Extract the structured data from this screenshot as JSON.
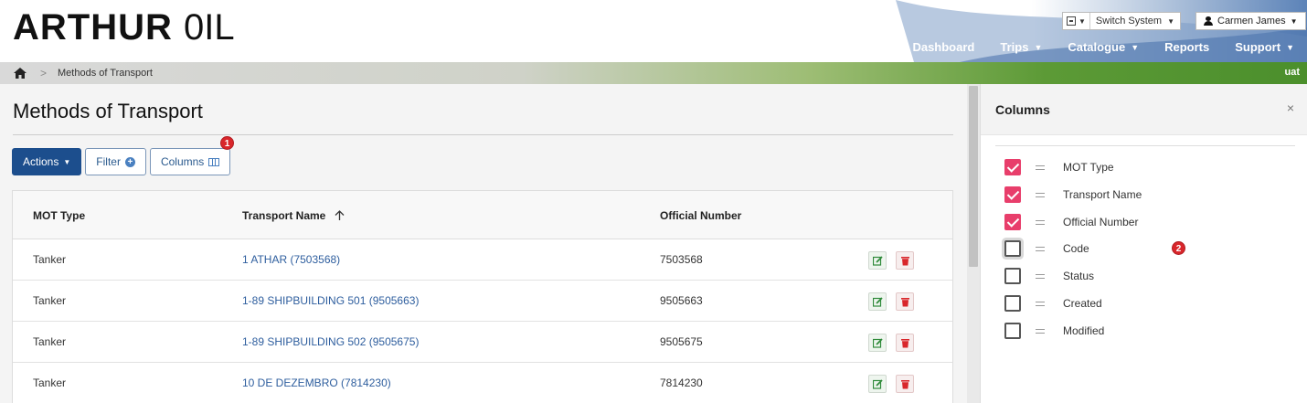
{
  "brand": {
    "logo_bold": "ARTHUR",
    "logo_thin": "0IL"
  },
  "header": {
    "system_switch_label": "Switch System",
    "user_name": "Carmen James",
    "nav": [
      {
        "label": "Dashboard",
        "has_menu": false
      },
      {
        "label": "Trips",
        "has_menu": true
      },
      {
        "label": "Catalogue",
        "has_menu": true
      },
      {
        "label": "Reports",
        "has_menu": false
      },
      {
        "label": "Support",
        "has_menu": true
      }
    ]
  },
  "breadcrumb": {
    "current": "Methods of Transport",
    "environment": "uat"
  },
  "page": {
    "title": "Methods of Transport"
  },
  "toolbar": {
    "actions_label": "Actions",
    "filter_label": "Filter",
    "columns_label": "Columns",
    "columns_badge": "1"
  },
  "table": {
    "headers": [
      "MOT Type",
      "Transport Name",
      "Official Number"
    ],
    "sorted_column": "Transport Name",
    "sort_direction": "ascending",
    "rows": [
      {
        "mot_type": "Tanker",
        "transport_name": "1 ATHAR (7503568)",
        "official_number": "7503568"
      },
      {
        "mot_type": "Tanker",
        "transport_name": "1-89 SHIPBUILDING 501 (9505663)",
        "official_number": "9505663"
      },
      {
        "mot_type": "Tanker",
        "transport_name": "1-89 SHIPBUILDING 502 (9505675)",
        "official_number": "9505675"
      },
      {
        "mot_type": "Tanker",
        "transport_name": "10 DE DEZEMBRO (7814230)",
        "official_number": "7814230"
      }
    ]
  },
  "columns_panel": {
    "title": "Columns",
    "close_symbol": "×",
    "marker_badge": "2",
    "items": [
      {
        "label": "MOT Type",
        "checked": true
      },
      {
        "label": "Transport Name",
        "checked": true
      },
      {
        "label": "Official Number",
        "checked": true
      },
      {
        "label": "Code",
        "checked": false
      },
      {
        "label": "Status",
        "checked": false
      },
      {
        "label": "Created",
        "checked": false
      },
      {
        "label": "Modified",
        "checked": false
      }
    ]
  },
  "colors": {
    "primary": "#1c4e8d",
    "link": "#2e5e9e",
    "checkbox_on": "#e83e6b",
    "badge": "#d9262b",
    "env_bar": "#4b8f2c"
  }
}
